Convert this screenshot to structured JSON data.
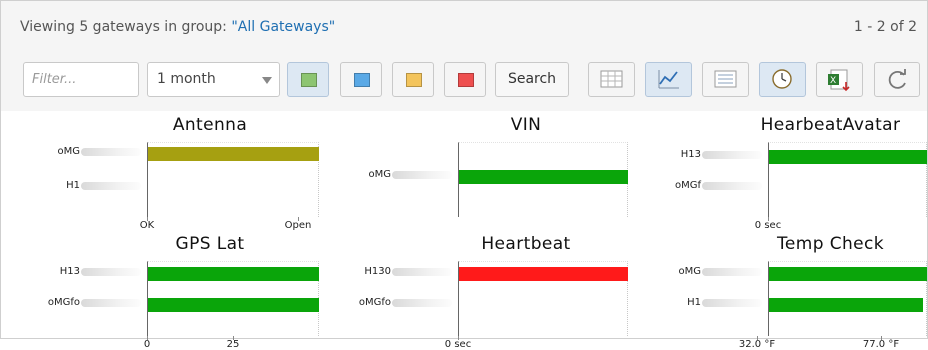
{
  "header": {
    "viewing_prefix": "Viewing 5 gateways in group: ",
    "group_name": "\"All Gateways\"",
    "pagination": "1 - 2 of 2"
  },
  "toolbar": {
    "filter_placeholder": "Filter...",
    "period_value": "1 month",
    "status_swatches": [
      {
        "name": "green-filter",
        "color": "#8dc572",
        "active": true
      },
      {
        "name": "blue-filter",
        "color": "#5aa9e6",
        "active": false
      },
      {
        "name": "yellow-filter",
        "color": "#f3c45c",
        "active": false
      },
      {
        "name": "red-filter",
        "color": "#ee4f4f",
        "active": false
      }
    ],
    "search_label": "Search",
    "view_buttons": [
      "table-view-icon",
      "chart-view-icon",
      "list-view-icon",
      "clock-icon",
      "excel-export-icon",
      "refresh-icon"
    ]
  },
  "colors": {
    "green": "#0aa50a",
    "olive": "#a6a011",
    "red": "#ff1a1a",
    "link": "#1f6fb2"
  },
  "charts": [
    {
      "title": "Antenna",
      "rows": [
        {
          "label": "oMG",
          "value": "Open",
          "color": "#a6a011"
        },
        {
          "label": "H1",
          "value": null,
          "color": null
        }
      ],
      "ticks": [
        "OK",
        "Open"
      ]
    },
    {
      "title": "VIN",
      "rows": [
        {
          "label": "oMG",
          "value": "full",
          "color": "#0aa50a"
        }
      ],
      "ticks": []
    },
    {
      "title": "HearbeatAvatar",
      "rows": [
        {
          "label": "H13",
          "value": "full",
          "color": "#0aa50a"
        },
        {
          "label": "oMGf",
          "value": null,
          "color": null
        }
      ],
      "ticks": [
        "0 sec"
      ]
    },
    {
      "title": "GPS Lat",
      "rows": [
        {
          "label": "H13",
          "value": "full",
          "color": "#0aa50a"
        },
        {
          "label": "oMGfo",
          "value": "full",
          "color": "#0aa50a"
        }
      ],
      "ticks": [
        "0",
        "25"
      ]
    },
    {
      "title": "Heartbeat",
      "rows": [
        {
          "label": "H130",
          "value": "full",
          "color": "#ff1a1a"
        },
        {
          "label": "oMGfo",
          "value": null,
          "color": null
        }
      ],
      "ticks": [
        "0 sec"
      ]
    },
    {
      "title": "Temp Check",
      "rows": [
        {
          "label": "oMG",
          "value": "full",
          "color": "#0aa50a"
        },
        {
          "label": "H1",
          "value": 75,
          "color": "#0aa50a"
        }
      ],
      "ticks": [
        "32.0 °F",
        "77.0 °F"
      ]
    }
  ]
}
